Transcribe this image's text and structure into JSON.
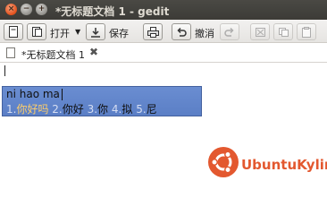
{
  "window": {
    "title": "*无标题文档 1 - gedit",
    "controls": {
      "close": "×",
      "minimize": "−",
      "maximize": "+"
    }
  },
  "toolbar": {
    "open_label": "打开",
    "open_arrow": "▼",
    "save_label": "保存",
    "undo_label": "撤消"
  },
  "tab": {
    "label": "*无标题文档 1",
    "close": "✖"
  },
  "ime": {
    "preedit": "ni hao ma",
    "candidates": [
      {
        "num": "1.",
        "text": "你好吗"
      },
      {
        "num": "2.",
        "text": "你好"
      },
      {
        "num": "3.",
        "text": "你"
      },
      {
        "num": "4.",
        "text": "拟"
      },
      {
        "num": "5.",
        "text": "尼"
      }
    ]
  },
  "logo": {
    "text": "UbuntuKylin"
  },
  "colors": {
    "titlebar": "#3c3b37",
    "close_button": "#e2501c",
    "ime_background": "#5b7fc6",
    "ime_highlight": "#ffcf6a",
    "brand": "#e3582f"
  }
}
